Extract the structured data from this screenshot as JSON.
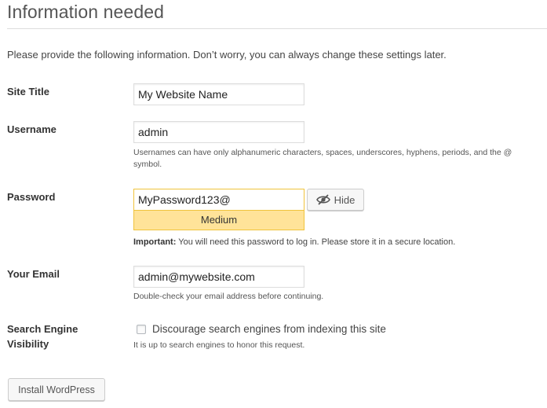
{
  "header": {
    "title": "Information needed",
    "intro": "Please provide the following information. Don’t worry, you can always change these settings later."
  },
  "form": {
    "site_title": {
      "label": "Site Title",
      "value": "My Website Name"
    },
    "username": {
      "label": "Username",
      "value": "admin",
      "hint": "Usernames can have only alphanumeric characters, spaces, underscores, hyphens, periods, and the @ symbol."
    },
    "password": {
      "label": "Password",
      "value": "MyPassword123@",
      "strength": "Medium",
      "strength_color": "#ffe399",
      "toggle_label": "Hide",
      "toggle_icon": "eye-slash-icon",
      "important_prefix": "Important:",
      "important_text": " You will need this password to log in. Please store it in a secure location."
    },
    "email": {
      "label": "Your Email",
      "value": "admin@mywebsite.com",
      "hint": "Double-check your email address before continuing."
    },
    "search_visibility": {
      "label_line1": "Search Engine",
      "label_line2": "Visibility",
      "checkbox_label": "Discourage search engines from indexing this site",
      "checked": false,
      "hint": "It is up to search engines to honor this request."
    }
  },
  "actions": {
    "install_label": "Install WordPress"
  }
}
